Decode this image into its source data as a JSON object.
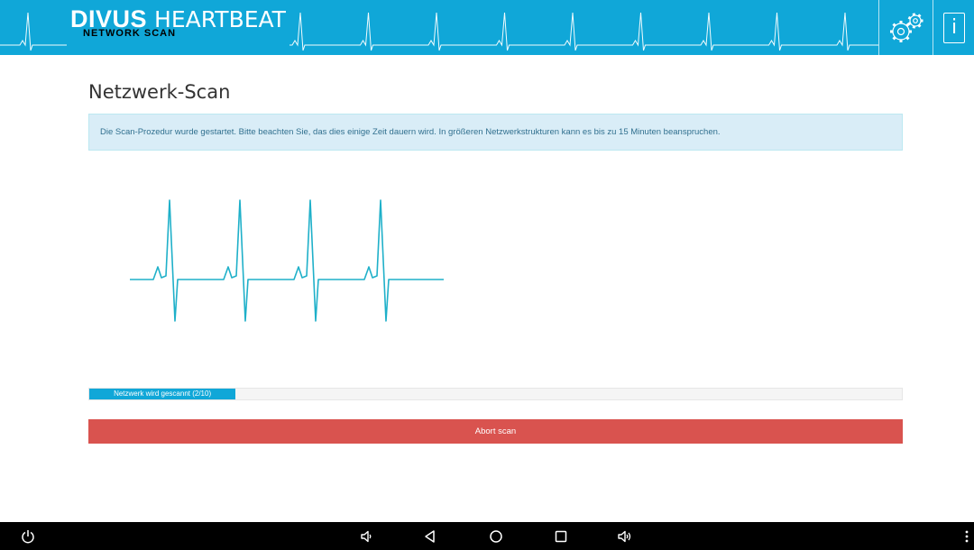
{
  "header": {
    "brand_part1": "DIVUS",
    "brand_part2": "HEARTBEAT",
    "subtitle": "NETWORK SCAN",
    "settings_icon": "gears-icon",
    "info_label": "i"
  },
  "main": {
    "title": "Netzwerk-Scan",
    "alert_text": "Die Scan-Prozedur wurde gestartet. Bitte beachten Sie, das dies einige Zeit dauern wird. In größeren Netzwerkstrukturen kann es bis zu 15 Minuten beanspruchen.",
    "progress": {
      "label": "Netzwerk wird gescannt (2/10)",
      "current": 2,
      "total": 10,
      "bar_fraction": 0.18
    },
    "abort_label": "Abort scan"
  },
  "navbar": {
    "icons": [
      "power-icon",
      "volume-down-icon",
      "back-icon",
      "home-icon",
      "recents-icon",
      "volume-up-icon",
      "more-vertical-icon"
    ]
  },
  "colors": {
    "brand": "#10a7d8",
    "alert_bg": "#d9edf7",
    "alert_text": "#31708f",
    "danger": "#d9534f",
    "ecg_stroke": "#1fb0c9"
  }
}
